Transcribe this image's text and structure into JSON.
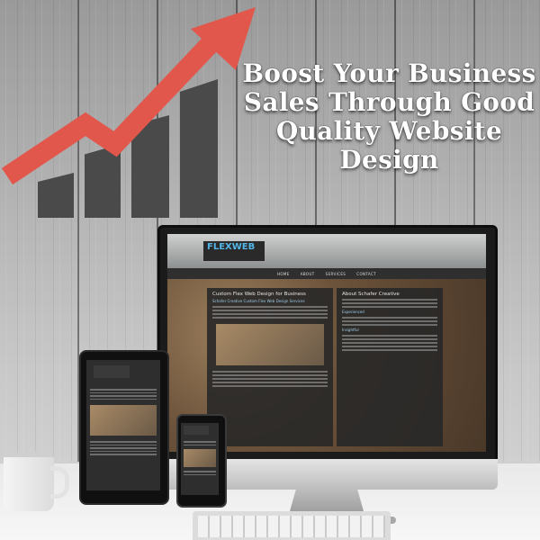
{
  "headline": {
    "line1": "Boost Your Business",
    "line2": "Sales Through Good",
    "line3": "Quality Website",
    "line4": "Design"
  },
  "colors": {
    "arrow": "#e2574c",
    "bars": "#4a4a4a",
    "text": "#ffffff",
    "accent_logo": "#53b6e6"
  },
  "site_mockup": {
    "logo": "FLEXWEB",
    "nav": [
      "HOME",
      "ABOUT",
      "SERVICES",
      "CONTACT"
    ],
    "left_title": "Custom Flex Web Design for Business",
    "left_sub": "Schafer Creative Custom Flex Web Design Services",
    "right_title": "About Schafer Creative",
    "right_sub": "Experienced",
    "right_sub2": "Insightful"
  },
  "icons": [
    "trend-arrow-icon",
    "bar-chart-icon"
  ]
}
